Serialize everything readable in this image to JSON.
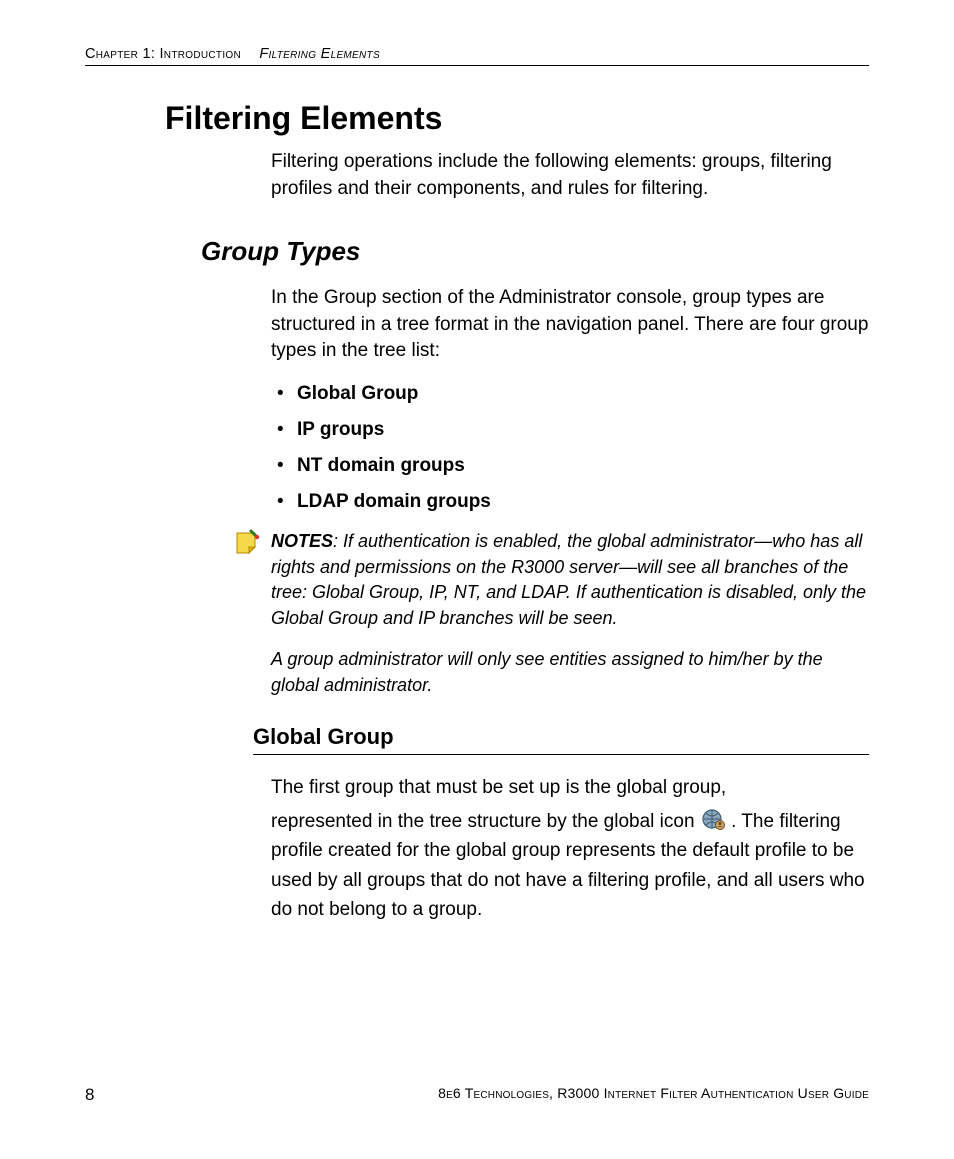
{
  "header": {
    "chapter": "Chapter 1: Introduction",
    "section": "Filtering Elements"
  },
  "title": "Filtering Elements",
  "intro": "Filtering operations include the following elements: groups, filtering profiles and their components, and rules for filtering.",
  "h2": "Group Types",
  "group_intro": "In the Group section of the Administrator console, group types are structured in a tree format in the navigation panel. There are four group types in the tree list:",
  "groups": {
    "g0": "Global Group",
    "g1": "IP groups",
    "g2": "NT domain groups",
    "g3": "LDAP domain groups"
  },
  "notes_label": "NOTES",
  "notes_body": ": If authentication is enabled, the global administrator—who has all rights and permissions on the R3000 server—will see all branches of the tree: Global Group, IP, NT, and LDAP. If authentication is disabled, only the Global Group and IP branches will be seen.",
  "notes_follow": "A group administrator will only see entities assigned to him/her by the global administrator.",
  "h3": "Global Group",
  "gg_p1": "The first group that must be set up is the global group,",
  "gg_p2a": "represented in the tree structure by the global icon ",
  "gg_p2b": ". The filtering profile created for the global group represents the default profile to be used by all groups that do not have a filtering profile, and all users who do not belong to a group.",
  "footer": {
    "page": "8",
    "text": "8e6 Technologies, R3000 Internet Filter Authentication User Guide"
  }
}
